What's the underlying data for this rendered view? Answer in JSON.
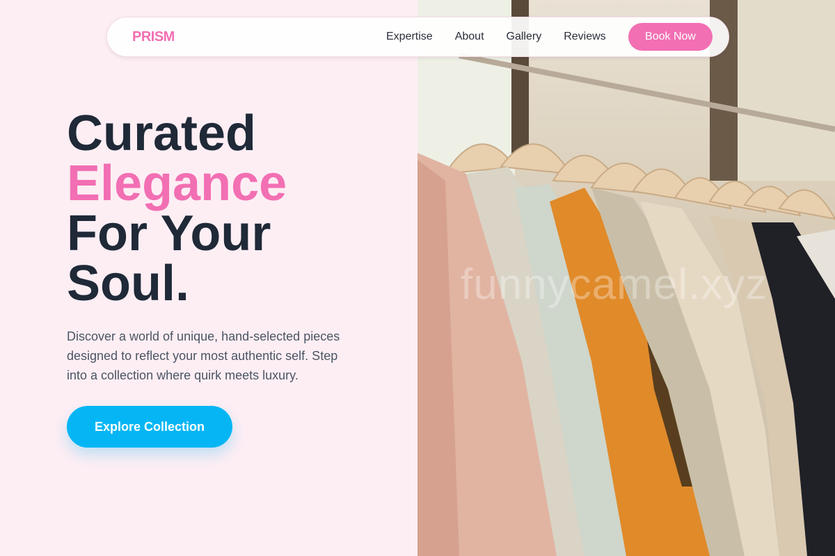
{
  "brand": "PRISM",
  "nav": {
    "links": [
      "Expertise",
      "About",
      "Gallery",
      "Reviews"
    ],
    "cta": "Book Now"
  },
  "hero": {
    "line1": "Curated",
    "line2": "Elegance",
    "line3": "For Your",
    "line4": "Soul.",
    "description": "Discover a world of unique, hand-selected pieces designed to reflect your most authentic self. Step into a collection where quirk meets luxury.",
    "button": "Explore Collection"
  },
  "image": {
    "subject": "clothing rack with garments on wooden hangers",
    "watermark": "funnycamel.xyz"
  },
  "colors": {
    "accent_pink": "#f26fb3",
    "cta_blue": "#06b6f4",
    "bg": "#fdeef4",
    "text_dark": "#1f2937"
  }
}
